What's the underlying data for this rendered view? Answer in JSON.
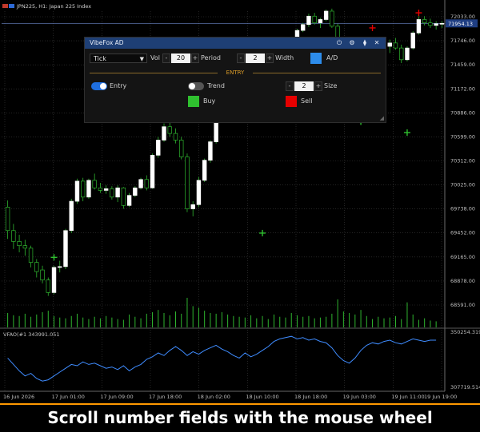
{
  "chart": {
    "symbol_title": "JPN225, H1:  Japan 225 Index",
    "current_price_label": "71954.13",
    "price_axis": [
      {
        "price": 72033,
        "label": "72033.00"
      },
      {
        "price": 71746,
        "label": "71746.00"
      },
      {
        "price": 71459,
        "label": "71459.00"
      },
      {
        "price": 71172,
        "label": "71172.00"
      },
      {
        "price": 70886,
        "label": "70886.00"
      },
      {
        "price": 70599,
        "label": "70599.00"
      },
      {
        "price": 70312,
        "label": "70312.00"
      },
      {
        "price": 70025,
        "label": "70025.00"
      },
      {
        "price": 69738,
        "label": "69738.00"
      },
      {
        "price": 69452,
        "label": "69452.00"
      },
      {
        "price": 69165,
        "label": "69165.00"
      },
      {
        "price": 68878,
        "label": "68878.00"
      },
      {
        "price": 68591,
        "label": "68591.00"
      }
    ],
    "time_axis": [
      "16 Jun 2026",
      "17 Jun 01:00",
      "17 Jun 09:00",
      "17 Jun 18:00",
      "18 Jun 02:00",
      "18 Jun 10:00",
      "18 Jun 18:00",
      "19 Jun 03:00",
      "19 Jun 11:00",
      "19 Jun 19:00"
    ],
    "candles": [
      {
        "o": 69760,
        "h": 69840,
        "l": 69380,
        "c": 69480
      },
      {
        "o": 69480,
        "h": 69560,
        "l": 69260,
        "c": 69350
      },
      {
        "o": 69350,
        "h": 69430,
        "l": 69220,
        "c": 69300
      },
      {
        "o": 69300,
        "h": 69370,
        "l": 69180,
        "c": 69270
      },
      {
        "o": 69270,
        "h": 69300,
        "l": 69040,
        "c": 69100
      },
      {
        "o": 69100,
        "h": 69140,
        "l": 68920,
        "c": 68990
      },
      {
        "o": 69010,
        "h": 69060,
        "l": 68850,
        "c": 68890
      },
      {
        "o": 68890,
        "h": 68920,
        "l": 68700,
        "c": 68740
      },
      {
        "o": 68740,
        "h": 69060,
        "l": 68720,
        "c": 69040
      },
      {
        "o": 69040,
        "h": 69120,
        "l": 68980,
        "c": 69050
      },
      {
        "o": 69050,
        "h": 69500,
        "l": 69020,
        "c": 69480
      },
      {
        "o": 69480,
        "h": 69860,
        "l": 69450,
        "c": 69830
      },
      {
        "o": 69830,
        "h": 70100,
        "l": 69800,
        "c": 70070
      },
      {
        "o": 70070,
        "h": 70110,
        "l": 69830,
        "c": 69880
      },
      {
        "o": 69880,
        "h": 70100,
        "l": 69860,
        "c": 70080
      },
      {
        "o": 70080,
        "h": 70160,
        "l": 69970,
        "c": 69990
      },
      {
        "o": 69990,
        "h": 70050,
        "l": 69930,
        "c": 69960
      },
      {
        "o": 69960,
        "h": 70020,
        "l": 69920,
        "c": 69980
      },
      {
        "o": 69980,
        "h": 70010,
        "l": 69850,
        "c": 69880
      },
      {
        "o": 69880,
        "h": 70020,
        "l": 69820,
        "c": 69990
      },
      {
        "o": 69990,
        "h": 70000,
        "l": 69740,
        "c": 69780
      },
      {
        "o": 69780,
        "h": 69930,
        "l": 69760,
        "c": 69900
      },
      {
        "o": 69900,
        "h": 70010,
        "l": 69880,
        "c": 69990
      },
      {
        "o": 69990,
        "h": 70110,
        "l": 69970,
        "c": 70090
      },
      {
        "o": 70090,
        "h": 70140,
        "l": 69960,
        "c": 69990
      },
      {
        "o": 69990,
        "h": 70400,
        "l": 69980,
        "c": 70380
      },
      {
        "o": 70380,
        "h": 70600,
        "l": 70350,
        "c": 70560
      },
      {
        "o": 70560,
        "h": 70760,
        "l": 70540,
        "c": 70720
      },
      {
        "o": 70720,
        "h": 70840,
        "l": 70600,
        "c": 70640
      },
      {
        "o": 70640,
        "h": 70700,
        "l": 70520,
        "c": 70560
      },
      {
        "o": 70560,
        "h": 70600,
        "l": 70330,
        "c": 70360
      },
      {
        "o": 70360,
        "h": 70400,
        "l": 69700,
        "c": 69740
      },
      {
        "o": 69740,
        "h": 69830,
        "l": 69650,
        "c": 69790
      },
      {
        "o": 69790,
        "h": 70120,
        "l": 69760,
        "c": 70080
      },
      {
        "o": 70080,
        "h": 70340,
        "l": 70060,
        "c": 70320
      },
      {
        "o": 70320,
        "h": 70560,
        "l": 70290,
        "c": 70540
      },
      {
        "o": 70540,
        "h": 70880,
        "l": 70520,
        "c": 70840
      },
      {
        "o": 70840,
        "h": 71000,
        "l": 70810,
        "c": 70950
      },
      {
        "o": 70950,
        "h": 71200,
        "l": 70930,
        "c": 71160
      },
      {
        "o": 71160,
        "h": 71230,
        "l": 71100,
        "c": 71200
      },
      {
        "o": 71200,
        "h": 71260,
        "l": 71140,
        "c": 71220
      },
      {
        "o": 71220,
        "h": 71280,
        "l": 71150,
        "c": 71250
      },
      {
        "o": 71250,
        "h": 71300,
        "l": 71200,
        "c": 71270
      },
      {
        "o": 71270,
        "h": 71320,
        "l": 71230,
        "c": 71300
      },
      {
        "o": 71300,
        "h": 71330,
        "l": 71260,
        "c": 71310
      },
      {
        "o": 71310,
        "h": 71360,
        "l": 71280,
        "c": 71350
      },
      {
        "o": 71350,
        "h": 71420,
        "l": 71320,
        "c": 71400
      },
      {
        "o": 71400,
        "h": 71520,
        "l": 71380,
        "c": 71500
      },
      {
        "o": 71500,
        "h": 71640,
        "l": 71480,
        "c": 71620
      },
      {
        "o": 71620,
        "h": 71780,
        "l": 71600,
        "c": 71760
      },
      {
        "o": 71760,
        "h": 71890,
        "l": 71740,
        "c": 71870
      },
      {
        "o": 71870,
        "h": 71960,
        "l": 71850,
        "c": 71940
      },
      {
        "o": 71940,
        "h": 72070,
        "l": 71910,
        "c": 72040
      },
      {
        "o": 72040,
        "h": 72080,
        "l": 71940,
        "c": 71960
      },
      {
        "o": 71960,
        "h": 72020,
        "l": 71900,
        "c": 72000
      },
      {
        "o": 72000,
        "h": 72120,
        "l": 71980,
        "c": 72100
      },
      {
        "o": 72100,
        "h": 72130,
        "l": 71900,
        "c": 71920
      },
      {
        "o": 71920,
        "h": 71950,
        "l": 71500,
        "c": 71520
      },
      {
        "o": 71520,
        "h": 71560,
        "l": 71280,
        "c": 71300
      },
      {
        "o": 71300,
        "h": 71320,
        "l": 70960,
        "c": 70980
      },
      {
        "o": 70980,
        "h": 71040,
        "l": 70860,
        "c": 70920
      },
      {
        "o": 70920,
        "h": 71000,
        "l": 70880,
        "c": 70960
      },
      {
        "o": 70960,
        "h": 71260,
        "l": 70940,
        "c": 71240
      },
      {
        "o": 71240,
        "h": 71460,
        "l": 71220,
        "c": 71440
      },
      {
        "o": 71440,
        "h": 71620,
        "l": 71420,
        "c": 71600
      },
      {
        "o": 71600,
        "h": 71720,
        "l": 71560,
        "c": 71680
      },
      {
        "o": 71680,
        "h": 71760,
        "l": 71600,
        "c": 71720
      },
      {
        "o": 71720,
        "h": 71780,
        "l": 71640,
        "c": 71660
      },
      {
        "o": 71660,
        "h": 71700,
        "l": 71480,
        "c": 71520
      },
      {
        "o": 71520,
        "h": 71680,
        "l": 71500,
        "c": 71660
      },
      {
        "o": 71660,
        "h": 71860,
        "l": 71640,
        "c": 71840
      },
      {
        "o": 71840,
        "h": 72040,
        "l": 71820,
        "c": 72000
      },
      {
        "o": 72000,
        "h": 72040,
        "l": 71930,
        "c": 71960
      },
      {
        "o": 71960,
        "h": 72010,
        "l": 71900,
        "c": 71930
      },
      {
        "o": 71930,
        "h": 71980,
        "l": 71880,
        "c": 71950
      },
      {
        "o": 71950,
        "h": 71980,
        "l": 71900,
        "c": 71954
      }
    ],
    "volumes": [
      38,
      32,
      30,
      36,
      28,
      34,
      40,
      44,
      30,
      26,
      24,
      30,
      36,
      26,
      22,
      28,
      24,
      30,
      26,
      22,
      20,
      34,
      28,
      24,
      36,
      40,
      46,
      38,
      32,
      42,
      36,
      44,
      56,
      52,
      44,
      38,
      36,
      40,
      34,
      30,
      28,
      26,
      32,
      24,
      30,
      22,
      34,
      28,
      26,
      38,
      32,
      28,
      30,
      24,
      26,
      28,
      36,
      50,
      42,
      38,
      34,
      46,
      30,
      22,
      28,
      24,
      26,
      30,
      22,
      28,
      34,
      20,
      24,
      18,
      16
    ],
    "volume_peaks": [
      {
        "index": 31,
        "value": 78
      },
      {
        "index": 57,
        "value": 74
      },
      {
        "index": 69,
        "value": 66
      }
    ],
    "markers": [
      {
        "type": "buy",
        "index": 8,
        "price": 69160
      },
      {
        "type": "buy",
        "index": 44,
        "price": 69450
      },
      {
        "type": "buy",
        "index": 61,
        "price": 70780
      },
      {
        "type": "buy",
        "index": 69,
        "price": 70650
      },
      {
        "type": "sell",
        "index": 63,
        "price": 71900
      },
      {
        "type": "sell",
        "index": 71,
        "price": 72080
      }
    ]
  },
  "indicator": {
    "label": "VFAO(#1 343991.051",
    "max_label": "350254.319",
    "min_label": "307719.514",
    "range": [
      307719.514,
      350254.319
    ],
    "values": [
      330000,
      325000,
      320000,
      316000,
      318000,
      314000,
      312000,
      313000,
      316000,
      319000,
      322000,
      325000,
      324000,
      327000,
      325000,
      326000,
      324000,
      322000,
      323000,
      321000,
      324000,
      320000,
      323000,
      325000,
      329000,
      331000,
      334000,
      332000,
      336000,
      339000,
      336000,
      332000,
      335000,
      333000,
      336000,
      338000,
      340000,
      337000,
      335000,
      332000,
      330000,
      334000,
      331000,
      333000,
      336000,
      339000,
      343000,
      345000,
      346000,
      347000,
      345000,
      346000,
      344000,
      345000,
      343000,
      342000,
      338000,
      332000,
      328000,
      326000,
      330000,
      336000,
      340000,
      342000,
      341000,
      343000,
      344000,
      342000,
      341000,
      343000,
      345000,
      344000,
      343000,
      344000,
      343991
    ]
  },
  "panel": {
    "title": "VibeFox AD",
    "icons": [
      "power-icon",
      "gear-icon",
      "pin-icon",
      "close-icon"
    ],
    "glyphs": {
      "power": "⏻",
      "gear": "⚙",
      "pin": "⧫",
      "close": "✕",
      "chevron": "▼",
      "minus": "-",
      "plus": "+",
      "resize": "◢"
    },
    "mode": "Tick",
    "vol_label": "Vol",
    "vol_value": "20",
    "period_label": "Period",
    "period_value": "2",
    "width_label": "Width",
    "ad_label": "A/D",
    "ad_color": "#2d8ceb",
    "section_label": "ENTRY",
    "entry_label": "Entry",
    "entry_on": true,
    "trend_label": "Trend",
    "trend_on": false,
    "size_value": "2",
    "size_label": "Size",
    "buy_label": "Buy",
    "buy_color": "#2fc02f",
    "sell_label": "Sell",
    "sell_color": "#e60000"
  },
  "caption": "Scroll number fields with the mouse wheel"
}
